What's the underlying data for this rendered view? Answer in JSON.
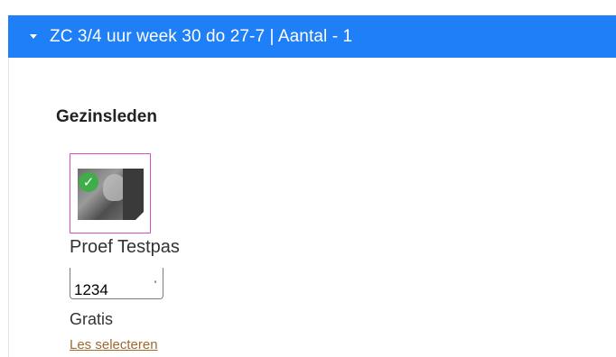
{
  "header": {
    "title": "ZC 3/4 uur week 30 do 27-7 | Aantal - 1",
    "expanded_icon": "caret-down-icon",
    "background_color": "#1f7ff7"
  },
  "section": {
    "title": "Gezinsleden"
  },
  "member": {
    "selected": true,
    "selected_icon": "check-icon",
    "check_glyph": "✓",
    "selected_border_color": "#d94fc7",
    "name": "Proef Testpas",
    "code_value": "1234",
    "code_mark": "'",
    "price": "Gratis",
    "select_link": "Les selecteren"
  }
}
